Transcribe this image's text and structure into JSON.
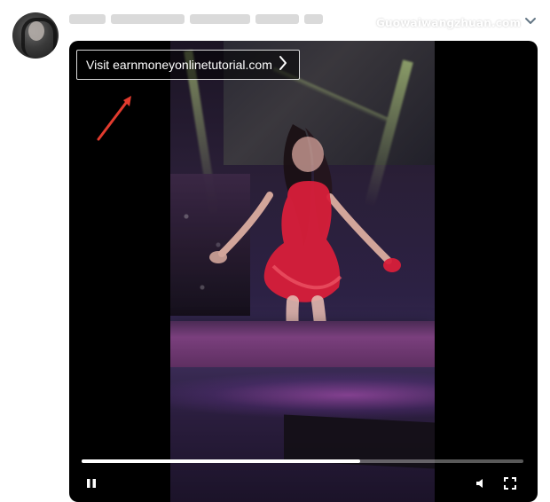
{
  "header": {
    "watermark_text": "Guowaiwangzhuan.com"
  },
  "video": {
    "visit_link_text": "Visit earnmoneyonlinetutorial.com",
    "progress_fraction": 0.63
  },
  "icons": {
    "more_menu": "chevron-down-icon",
    "visit_chevron": "chevron-right-icon",
    "play_pause": "pause-icon",
    "volume": "volume-icon"
  },
  "colors": {
    "page_bg": "#ffffff",
    "video_bg": "#000000",
    "dress_red": "#d81f3a",
    "annotation_red": "#e23b2e"
  }
}
